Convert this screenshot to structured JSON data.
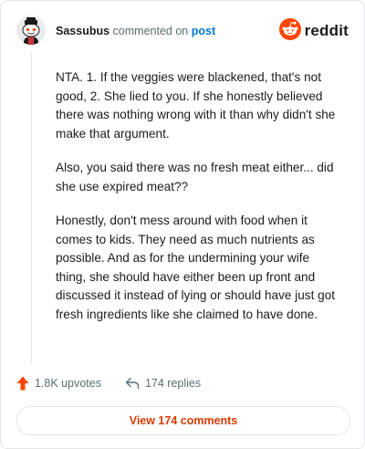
{
  "comment": {
    "username": "Sassubus",
    "action_text": "commented on",
    "post_link": "post",
    "paragraphs": [
      "NTA. 1. If the veggies were blackened, that's not good, 2. She lied to you. If she honestly believed there was nothing wrong with it than why didn't she make that argument.",
      "Also, you said there was no fresh meat either... did she use expired meat??",
      "Honestly, don't mess around with food when it comes to kids. They need as much nutrients as possible. And as for the undermining your wife thing, she should have either been up front and discussed it instead of lying or should have just got fresh ingredients like she claimed to have done."
    ]
  },
  "brand": {
    "wordmark": "reddit",
    "color": "#ff4500"
  },
  "footer": {
    "upvotes": "1.8K upvotes",
    "replies": "174 replies",
    "view_button": "View 174 comments"
  },
  "icons": {
    "avatar": "snoo-avatar",
    "logo": "reddit-snoo-icon",
    "upvote": "upvote-arrow-icon",
    "reply": "reply-arrow-icon"
  },
  "colors": {
    "accent": "#d93a00",
    "upvote": "#ff4500",
    "link": "#0079d3",
    "muted": "#576f76"
  }
}
